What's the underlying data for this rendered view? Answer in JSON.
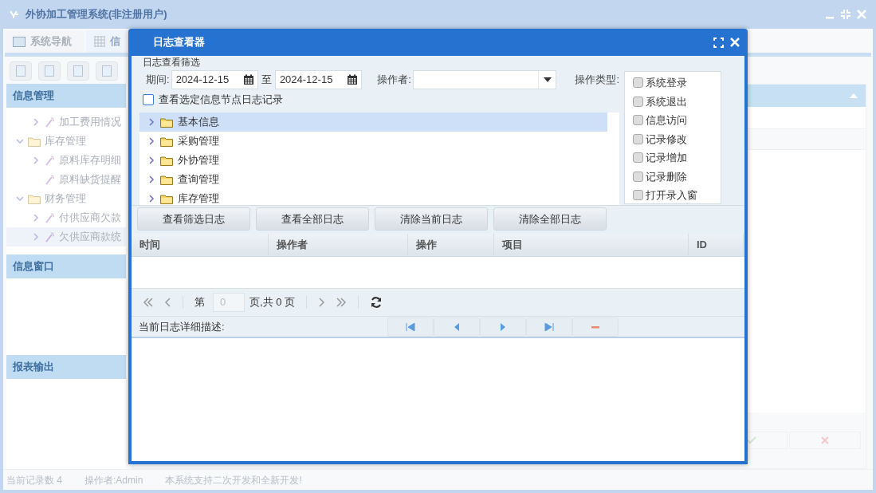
{
  "window": {
    "title": "外协加工管理系统(非注册用户)"
  },
  "tabs": [
    {
      "label": "系统导航",
      "selected": false,
      "kind": "monitor"
    },
    {
      "label": "信",
      "selected": true,
      "kind": "grid"
    }
  ],
  "sidebar": {
    "sections": [
      {
        "title": "信息管理",
        "tree": [
          {
            "children": [
              {
                "label": "加工费用情况",
                "kind": "page",
                "expanded": false,
                "selected": false
              }
            ]
          },
          {
            "label": "库存管理",
            "kind": "folder",
            "expanded": true,
            "selected": false,
            "children": [
              {
                "label": "原料库存明细",
                "kind": "page",
                "expanded": false,
                "selected": false
              },
              {
                "label": "原料缺货提醒",
                "kind": "page",
                "leaf": true,
                "selected": false
              }
            ]
          },
          {
            "label": "财务管理",
            "kind": "folder",
            "expanded": true,
            "selected": false,
            "children": [
              {
                "label": "付供应商欠款",
                "kind": "page",
                "expanded": false,
                "selected": false
              },
              {
                "label": "欠供应商款统",
                "kind": "page",
                "expanded": false,
                "selected": true
              }
            ]
          }
        ]
      },
      {
        "title": "信息窗口"
      },
      {
        "title": "报表输出"
      }
    ]
  },
  "status_bar": [
    "当前记录数 4",
    "操作者:Admin",
    "本系统支持二次开发和全新开发!"
  ],
  "dialog": {
    "title": "日志查看器",
    "filter": {
      "legend": "日志查看筛选",
      "period_label": "期间:",
      "from": "2024-12-15",
      "to_label": "至",
      "to": "2024-12-15",
      "operator_label": "操作者:",
      "type_label": "操作类型:",
      "node_only": {
        "label": "查看选定信息节点日志记录",
        "checked": false
      },
      "types": [
        {
          "label": "系统登录",
          "checked": false
        },
        {
          "label": "系统退出",
          "checked": false
        },
        {
          "label": "信息访问",
          "checked": false
        },
        {
          "label": "记录修改",
          "checked": false
        },
        {
          "label": "记录增加",
          "checked": false
        },
        {
          "label": "记录删除",
          "checked": false
        },
        {
          "label": "打开录入窗",
          "checked": false
        }
      ],
      "tree": [
        {
          "label": "基本信息",
          "selected": true,
          "expanded": false
        },
        {
          "label": "采购管理",
          "selected": false,
          "expanded": false
        },
        {
          "label": "外协管理",
          "selected": false,
          "expanded": false
        },
        {
          "label": "查询管理",
          "selected": false,
          "expanded": false
        },
        {
          "label": "库存管理",
          "selected": false,
          "expanded": false
        }
      ]
    },
    "buttons": [
      "查看筛选日志",
      "查看全部日志",
      "清除当前日志",
      "清除全部日志"
    ],
    "table": {
      "columns": [
        "时间",
        "操作者",
        "操作",
        "项目",
        "ID"
      ]
    },
    "pager": {
      "page_label": "第",
      "page": "0",
      "total": "页,共 0 页"
    },
    "detail_label": "当前日志详细描述:"
  }
}
